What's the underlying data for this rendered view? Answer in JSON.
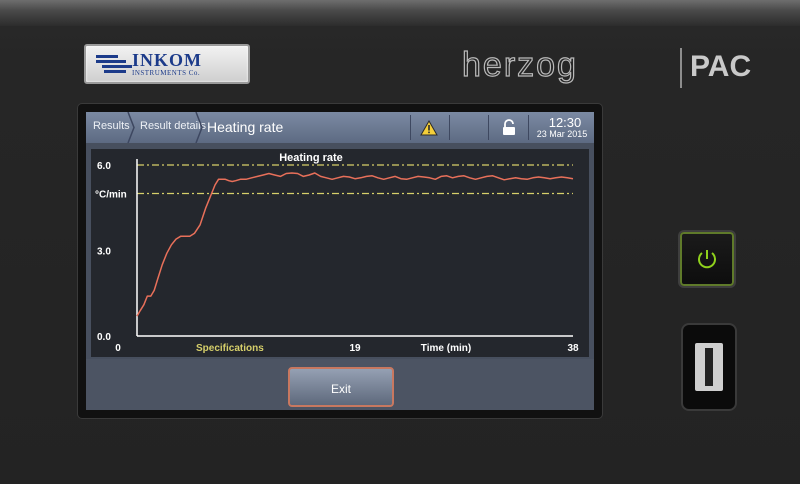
{
  "device": {
    "badge": {
      "name": "INKOM",
      "subtitle": "INSTRUMENTS Co."
    },
    "brand": {
      "left": "herzog",
      "right": "PAC"
    }
  },
  "screen": {
    "breadcrumbs": [
      "Results",
      "Result details"
    ],
    "title": "Heating rate",
    "status_icons": [
      "warning-icon",
      "unlocked-icon"
    ],
    "clock": {
      "time": "12:30",
      "date": "23 Mar 2015"
    },
    "footer": {
      "exit_label": "Exit"
    }
  },
  "chart_data": {
    "type": "line",
    "title": "Heating rate",
    "ylabel": "°C/min",
    "xlabel": "Time (min)",
    "xlim": [
      0,
      38
    ],
    "ylim": [
      0,
      6
    ],
    "y_ticks": [
      "0.0",
      "3.0",
      "6.0"
    ],
    "x_ticks": [
      "0",
      "19",
      "38"
    ],
    "legend": "Specifications",
    "colors": {
      "line": "#e8705a",
      "spec": "#d6cf6a",
      "axis": "#ffffff"
    },
    "specifications": [
      6.0,
      5.0
    ],
    "series": [
      {
        "x": [
          0.0,
          0.3,
          0.6,
          0.9,
          1.2,
          1.5,
          1.8,
          2.2,
          2.6,
          3.0,
          3.4,
          3.8,
          4.2,
          4.6,
          5.0,
          5.5,
          6.0,
          6.5,
          6.8,
          7.1,
          7.4,
          7.7,
          8.0,
          8.3,
          8.6,
          9.0,
          9.5,
          10,
          10.5,
          11,
          11.5,
          12,
          12.5,
          13,
          13.5,
          14,
          14.5,
          15,
          15.5,
          16,
          16.5,
          17,
          17.5,
          18,
          18.5,
          19,
          19.5,
          20,
          20.5,
          21,
          21.5,
          22,
          22.5,
          23,
          23.5,
          24,
          24.5,
          25,
          25.5,
          26,
          26.5,
          27,
          27.5,
          28,
          28.5,
          29,
          29.5,
          30,
          30.5,
          31,
          31.5,
          32,
          32.5,
          33,
          33.5,
          34,
          34.5,
          35,
          35.5,
          36,
          36.5,
          37,
          37.5,
          38
        ],
        "y": [
          0.7,
          0.9,
          1.1,
          1.4,
          1.4,
          1.6,
          2.0,
          2.5,
          2.9,
          3.2,
          3.4,
          3.5,
          3.5,
          3.5,
          3.6,
          3.9,
          4.5,
          5.0,
          5.3,
          5.5,
          5.5,
          5.5,
          5.45,
          5.42,
          5.45,
          5.5,
          5.5,
          5.55,
          5.6,
          5.65,
          5.7,
          5.65,
          5.6,
          5.7,
          5.72,
          5.7,
          5.6,
          5.65,
          5.72,
          5.6,
          5.55,
          5.5,
          5.55,
          5.6,
          5.58,
          5.52,
          5.55,
          5.6,
          5.62,
          5.55,
          5.5,
          5.55,
          5.6,
          5.52,
          5.5,
          5.55,
          5.6,
          5.58,
          5.55,
          5.5,
          5.6,
          5.62,
          5.55,
          5.6,
          5.62,
          5.55,
          5.5,
          5.55,
          5.6,
          5.62,
          5.55,
          5.48,
          5.52,
          5.55,
          5.52,
          5.5,
          5.55,
          5.58,
          5.55,
          5.52,
          5.55,
          5.58,
          5.55,
          5.52
        ]
      }
    ]
  }
}
